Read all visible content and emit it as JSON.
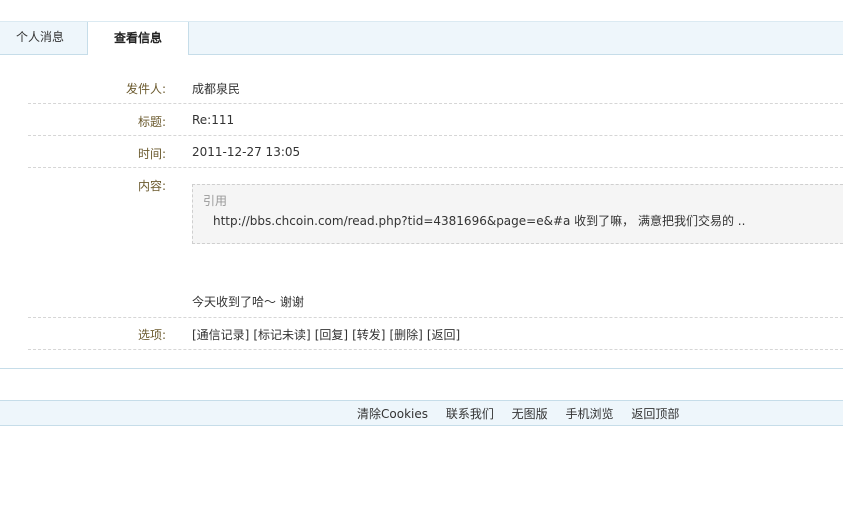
{
  "tabs": {
    "messages_label": "个人消息",
    "view_label": "查看信息"
  },
  "message": {
    "sender_label": "发件人:",
    "sender": "成都泉民",
    "title_label": "标题:",
    "title": "Re:111",
    "time_label": "时间:",
    "time": "2011-12-27 13:05",
    "content_label": "内容:",
    "quote_title": "引用",
    "quote_text": "http://bbs.chcoin.com/read.php?tid=4381696&page=e&#a  收到了嘛， 满意把我们交易的 ..",
    "reply_text": "今天收到了哈～ 谢谢"
  },
  "options": {
    "label": "选项:",
    "items": [
      "[通信记录]",
      "[标记未读]",
      "[回复]",
      "[转发]",
      "[删除]",
      "[返回]"
    ]
  },
  "footer": {
    "links": [
      "清除Cookies",
      "联系我们",
      "无图版",
      "手机浏览",
      "返回顶部"
    ]
  },
  "colors": {
    "tab_bar_bg": "#eef6fb",
    "label_color": "#6b5a2e",
    "border_color": "#c6dde9"
  }
}
